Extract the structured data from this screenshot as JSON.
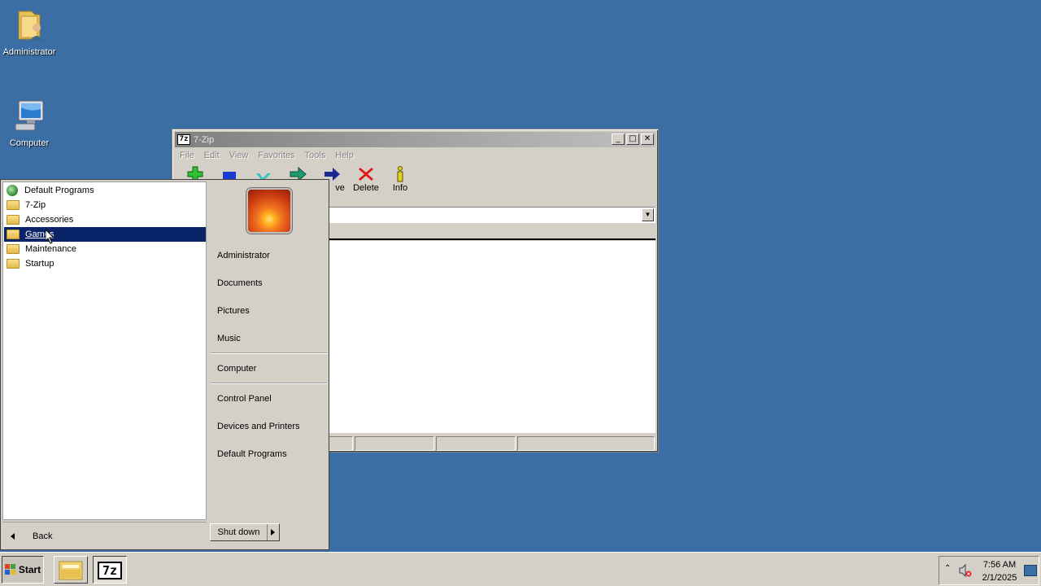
{
  "desktop": {
    "icons": [
      {
        "label": "Administrator",
        "icon": "user-folder-icon"
      },
      {
        "label": "Computer",
        "icon": "computer-icon"
      }
    ]
  },
  "window": {
    "app_icon_text": "7z",
    "title": "7-Zip",
    "controls": {
      "minimize": "_",
      "maximize": "□",
      "close": "✕"
    },
    "menu": [
      "File",
      "Edit",
      "View",
      "Favorites",
      "Tools",
      "Help"
    ],
    "toolbar": {
      "move_label_partial": "ve",
      "delete_label": "Delete",
      "info_label": "Info"
    }
  },
  "startmenu": {
    "programs": [
      {
        "label": "Default Programs",
        "icon": "default-programs-icon"
      },
      {
        "label": "7-Zip",
        "icon": "folder-icon"
      },
      {
        "label": "Accessories",
        "icon": "folder-icon"
      },
      {
        "label": "Games",
        "icon": "folder-icon",
        "highlighted": true
      },
      {
        "label": "Maintenance",
        "icon": "folder-icon"
      },
      {
        "label": "Startup",
        "icon": "folder-icon"
      }
    ],
    "back_label": "Back",
    "right": {
      "user": "Administrator",
      "documents": "Documents",
      "pictures": "Pictures",
      "music": "Music",
      "computer": "Computer",
      "control_panel": "Control Panel",
      "devices": "Devices and Printers",
      "default_programs": "Default Programs"
    },
    "shutdown_label": "Shut down"
  },
  "taskbar": {
    "start_label": "Start",
    "seven_zip_text": "7z",
    "clock_time": "7:56 AM",
    "clock_date": "2/1/2025"
  },
  "colors": {
    "desktop": "#3a6ea5",
    "highlight": "#0a246a",
    "chrome": "#d4d0c8"
  }
}
